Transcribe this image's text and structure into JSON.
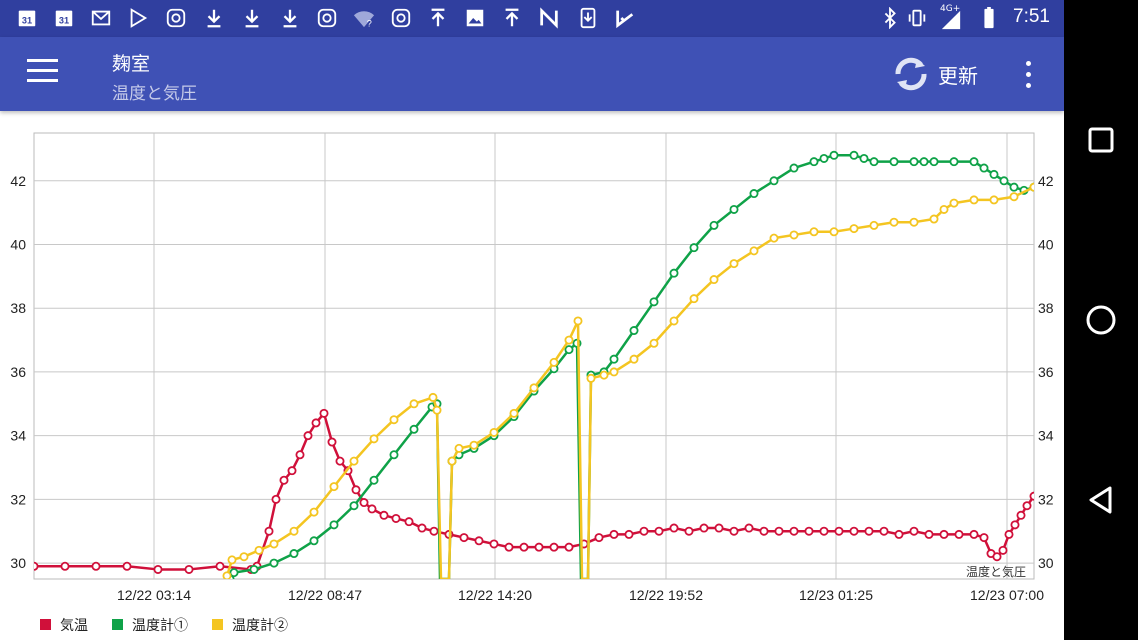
{
  "status_bar": {
    "time": "7:51",
    "network": "4G+",
    "left_icons": [
      "calendar-icon",
      "calendar-icon",
      "gmail-icon",
      "play-store-icon",
      "instagram-icon",
      "download-icon",
      "download-icon",
      "download-icon",
      "instagram-icon",
      "wifi-question-icon",
      "instagram-icon",
      "upload-icon",
      "image-icon",
      "upload-icon",
      "n-app-icon",
      "download-box-icon",
      "check-app-icon"
    ],
    "calendar_day": "31",
    "wifi_mark": "?"
  },
  "app_bar": {
    "title": "麹室",
    "subtitle": "温度と気圧",
    "refresh_label": "更新"
  },
  "chart_data": {
    "type": "line",
    "x_labels": [
      "12/22 03:14",
      "12/22 08:47",
      "12/22 14:20",
      "12/22 19:52",
      "12/23 01:25",
      "12/23 07:00"
    ],
    "ylim": [
      29.5,
      43.5
    ],
    "y_ticks": [
      30,
      32,
      34,
      36,
      38,
      40,
      42
    ],
    "watermark": "温度と気圧",
    "grid": true,
    "legend_position": "bottom-left",
    "series": [
      {
        "name": "気温",
        "color": "#d0103a",
        "points": [
          [
            0.0,
            29.9
          ],
          [
            3.1,
            29.9
          ],
          [
            6.2,
            29.9
          ],
          [
            9.3,
            29.9
          ],
          [
            12.4,
            29.8
          ],
          [
            15.5,
            29.8
          ],
          [
            18.6,
            29.9
          ],
          [
            21.7,
            29.8
          ],
          [
            22.3,
            29.9
          ],
          [
            23.5,
            31.0
          ],
          [
            24.2,
            32.0
          ],
          [
            25.0,
            32.6
          ],
          [
            25.8,
            32.9
          ],
          [
            26.6,
            33.4
          ],
          [
            27.4,
            34.0
          ],
          [
            28.2,
            34.4
          ],
          [
            29.0,
            34.7
          ],
          [
            29.8,
            33.8
          ],
          [
            30.6,
            33.2
          ],
          [
            31.4,
            32.9
          ],
          [
            32.2,
            32.3
          ],
          [
            33.0,
            31.9
          ],
          [
            33.8,
            31.7
          ],
          [
            35.0,
            31.5
          ],
          [
            36.2,
            31.4
          ],
          [
            37.5,
            31.3
          ],
          [
            38.8,
            31.1
          ],
          [
            40.0,
            31.0
          ],
          [
            41.5,
            30.9
          ],
          [
            43.0,
            30.8
          ],
          [
            44.5,
            30.7
          ],
          [
            46.0,
            30.6
          ],
          [
            47.5,
            30.5
          ],
          [
            49.0,
            30.5
          ],
          [
            50.5,
            30.5
          ],
          [
            52.0,
            30.5
          ],
          [
            53.5,
            30.5
          ],
          [
            55.0,
            30.6
          ],
          [
            56.5,
            30.8
          ],
          [
            58.0,
            30.9
          ],
          [
            59.5,
            30.9
          ],
          [
            61.0,
            31.0
          ],
          [
            62.5,
            31.0
          ],
          [
            64.0,
            31.1
          ],
          [
            65.5,
            31.0
          ],
          [
            67.0,
            31.1
          ],
          [
            68.5,
            31.1
          ],
          [
            70.0,
            31.0
          ],
          [
            71.5,
            31.1
          ],
          [
            73.0,
            31.0
          ],
          [
            74.5,
            31.0
          ],
          [
            76.0,
            31.0
          ],
          [
            77.5,
            31.0
          ],
          [
            79.0,
            31.0
          ],
          [
            80.5,
            31.0
          ],
          [
            82.0,
            31.0
          ],
          [
            83.5,
            31.0
          ],
          [
            85.0,
            31.0
          ],
          [
            86.5,
            30.9
          ],
          [
            88.0,
            31.0
          ],
          [
            89.5,
            30.9
          ],
          [
            91.0,
            30.9
          ],
          [
            92.5,
            30.9
          ],
          [
            94.0,
            30.9
          ],
          [
            95.0,
            30.8
          ],
          [
            95.7,
            30.3
          ],
          [
            96.3,
            30.2
          ],
          [
            96.9,
            30.4
          ],
          [
            97.5,
            30.9
          ],
          [
            98.1,
            31.2
          ],
          [
            98.7,
            31.5
          ],
          [
            99.3,
            31.8
          ],
          [
            100.0,
            32.1
          ]
        ]
      },
      {
        "name": "温度計①",
        "color": "#0fa248",
        "points": [
          [
            19.6,
            29.5
          ],
          [
            20.0,
            29.7
          ],
          [
            22.0,
            29.8
          ],
          [
            24.0,
            30.0
          ],
          [
            26.0,
            30.3
          ],
          [
            28.0,
            30.7
          ],
          [
            30.0,
            31.2
          ],
          [
            32.0,
            31.8
          ],
          [
            34.0,
            32.6
          ],
          [
            36.0,
            33.4
          ],
          [
            38.0,
            34.2
          ],
          [
            39.8,
            34.9
          ],
          [
            40.3,
            35.0
          ],
          [
            40.6,
            29.0
          ],
          [
            41.5,
            29.0
          ],
          [
            41.8,
            33.2
          ],
          [
            42.5,
            33.4
          ],
          [
            44.0,
            33.6
          ],
          [
            46.0,
            34.0
          ],
          [
            48.0,
            34.6
          ],
          [
            50.0,
            35.4
          ],
          [
            52.0,
            36.1
          ],
          [
            53.5,
            36.7
          ],
          [
            54.3,
            36.9
          ],
          [
            54.7,
            29.0
          ],
          [
            55.4,
            29.0
          ],
          [
            55.7,
            35.9
          ],
          [
            57.0,
            36.0
          ],
          [
            58.0,
            36.4
          ],
          [
            60.0,
            37.3
          ],
          [
            62.0,
            38.2
          ],
          [
            64.0,
            39.1
          ],
          [
            66.0,
            39.9
          ],
          [
            68.0,
            40.6
          ],
          [
            70.0,
            41.1
          ],
          [
            72.0,
            41.6
          ],
          [
            74.0,
            42.0
          ],
          [
            76.0,
            42.4
          ],
          [
            78.0,
            42.6
          ],
          [
            79.0,
            42.7
          ],
          [
            80.0,
            42.8
          ],
          [
            82.0,
            42.8
          ],
          [
            83.0,
            42.7
          ],
          [
            84.0,
            42.6
          ],
          [
            86.0,
            42.6
          ],
          [
            88.0,
            42.6
          ],
          [
            89.0,
            42.6
          ],
          [
            90.0,
            42.6
          ],
          [
            92.0,
            42.6
          ],
          [
            94.0,
            42.6
          ],
          [
            95.0,
            42.4
          ],
          [
            96.0,
            42.2
          ],
          [
            97.0,
            42.0
          ],
          [
            98.0,
            41.8
          ],
          [
            99.0,
            41.7
          ],
          [
            100.0,
            41.8
          ]
        ]
      },
      {
        "name": "温度計②",
        "color": "#f4c521",
        "points": [
          [
            19.3,
            29.6
          ],
          [
            19.8,
            30.1
          ],
          [
            21.0,
            30.2
          ],
          [
            22.5,
            30.4
          ],
          [
            24.0,
            30.6
          ],
          [
            26.0,
            31.0
          ],
          [
            28.0,
            31.6
          ],
          [
            30.0,
            32.4
          ],
          [
            32.0,
            33.2
          ],
          [
            34.0,
            33.9
          ],
          [
            36.0,
            34.5
          ],
          [
            38.0,
            35.0
          ],
          [
            39.9,
            35.2
          ],
          [
            40.3,
            34.8
          ],
          [
            40.7,
            29.0
          ],
          [
            41.5,
            29.0
          ],
          [
            41.8,
            33.2
          ],
          [
            42.5,
            33.6
          ],
          [
            44.0,
            33.7
          ],
          [
            46.0,
            34.1
          ],
          [
            48.0,
            34.7
          ],
          [
            50.0,
            35.5
          ],
          [
            52.0,
            36.3
          ],
          [
            53.5,
            37.0
          ],
          [
            54.4,
            37.6
          ],
          [
            54.8,
            29.0
          ],
          [
            55.4,
            29.0
          ],
          [
            55.7,
            35.8
          ],
          [
            57.0,
            35.9
          ],
          [
            58.0,
            36.0
          ],
          [
            60.0,
            36.4
          ],
          [
            62.0,
            36.9
          ],
          [
            64.0,
            37.6
          ],
          [
            66.0,
            38.3
          ],
          [
            68.0,
            38.9
          ],
          [
            70.0,
            39.4
          ],
          [
            72.0,
            39.8
          ],
          [
            74.0,
            40.2
          ],
          [
            76.0,
            40.3
          ],
          [
            78.0,
            40.4
          ],
          [
            80.0,
            40.4
          ],
          [
            82.0,
            40.5
          ],
          [
            84.0,
            40.6
          ],
          [
            86.0,
            40.7
          ],
          [
            88.0,
            40.7
          ],
          [
            90.0,
            40.8
          ],
          [
            91.0,
            41.1
          ],
          [
            92.0,
            41.3
          ],
          [
            94.0,
            41.4
          ],
          [
            96.0,
            41.4
          ],
          [
            98.0,
            41.5
          ],
          [
            100.0,
            41.8
          ]
        ]
      }
    ]
  }
}
